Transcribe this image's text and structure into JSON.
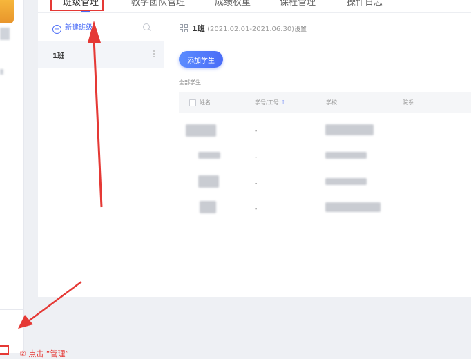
{
  "tabs": [
    {
      "label": "班级管理",
      "active": true
    },
    {
      "label": "教学团队管理",
      "active": false
    },
    {
      "label": "成绩权重",
      "active": false
    },
    {
      "label": "课程管理",
      "active": false
    },
    {
      "label": "操作日志",
      "active": false
    }
  ],
  "class_list": {
    "new_class_label": "新建班级",
    "items": [
      {
        "label": "1班"
      }
    ]
  },
  "class_detail": {
    "name": "1班",
    "date_range": "(2021.02.01-2021.06.30)",
    "settings_label": "设置",
    "add_student_label": "添加学生",
    "section_label": "全部学生",
    "columns": [
      "姓名",
      "学号/工号",
      "学校",
      "院系"
    ],
    "rows": [
      {
        "id": "-"
      },
      {
        "id": "-"
      },
      {
        "id": "-"
      },
      {
        "id": "-"
      }
    ]
  },
  "annotation": {
    "text": "② 点击 “管理”",
    "color": "#e53935"
  },
  "colors": {
    "accent": "#4a6cf7",
    "annotation_red": "#e53935"
  }
}
